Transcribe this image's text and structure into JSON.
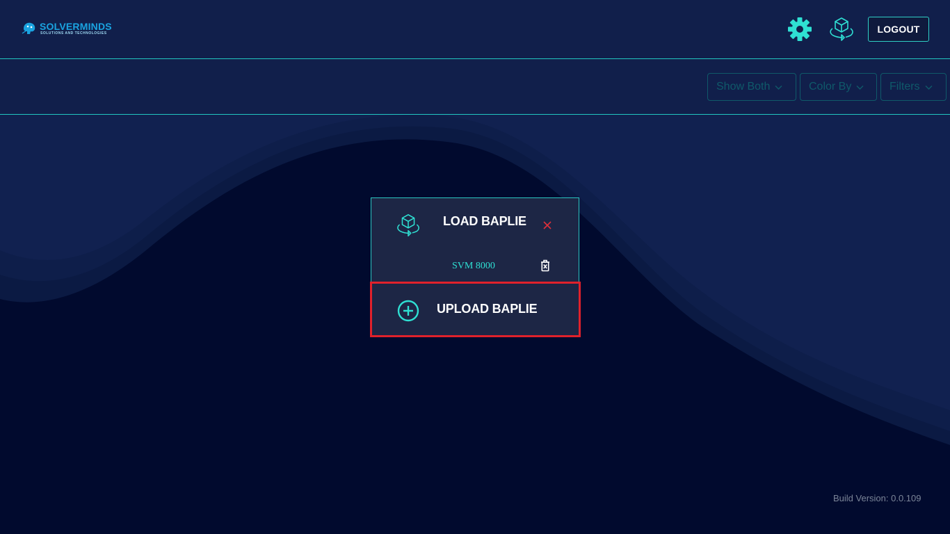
{
  "header": {
    "logo": {
      "name": "SOLVERMINDS",
      "tagline": "SOLUTIONS AND TECHNOLOGIES"
    },
    "settings_icon": "gear-icon",
    "load_icon": "cube-rotate-icon",
    "logout_label": "LOGOUT"
  },
  "toolbar": {
    "show_label": "Show Both",
    "color_label": "Color By",
    "filters_label": "Filters"
  },
  "dialog": {
    "title": "LOAD BAPLIE",
    "items": [
      {
        "label": "SVM 8000"
      }
    ],
    "upload_label": "UPLOAD BAPLIE"
  },
  "footer": {
    "build_version": "Build Version: 0.0.109"
  },
  "colors": {
    "background": "#010a2e",
    "accent_teal": "#2fe0d3",
    "panel": "#1d2645",
    "close_red": "#e0303a",
    "highlight_red": "#e0212b"
  }
}
